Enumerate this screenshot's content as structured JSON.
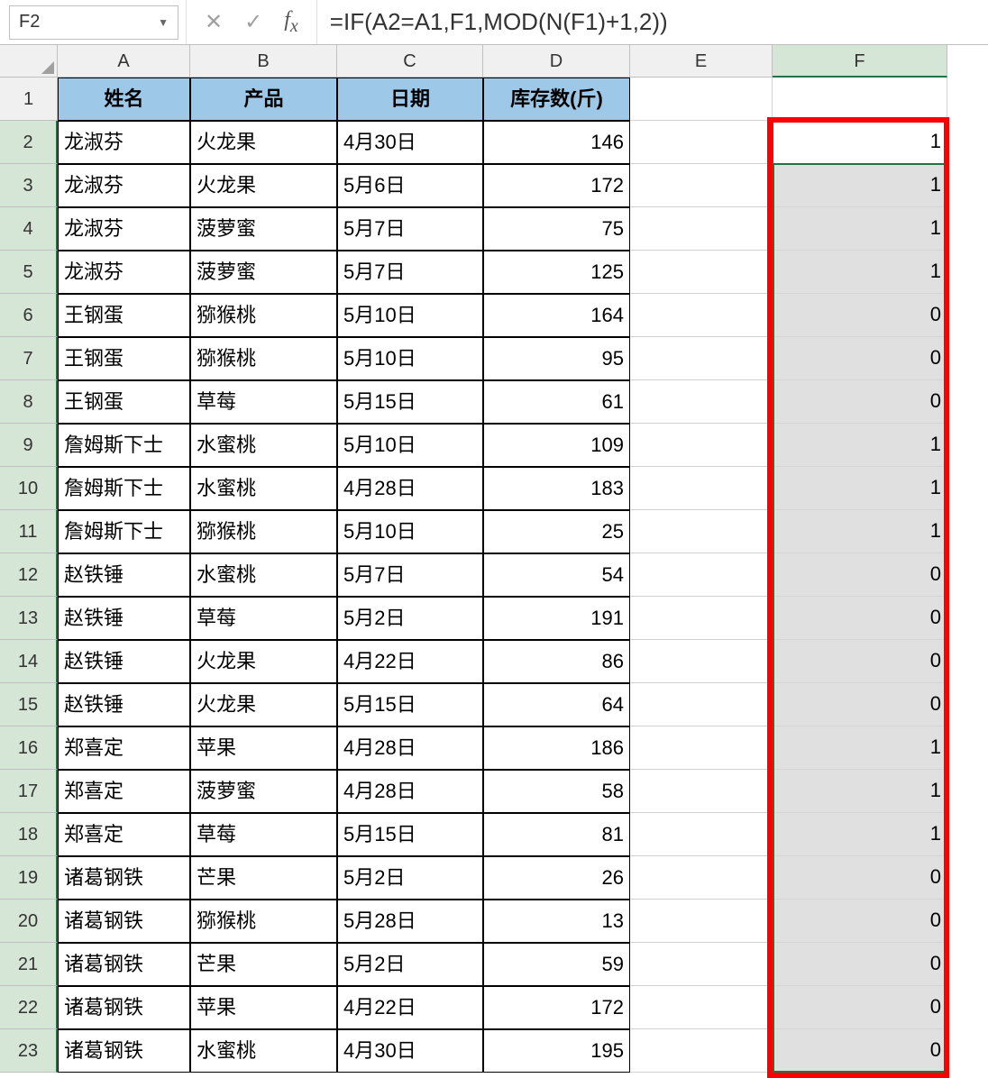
{
  "name_box": "F2",
  "formula": "=IF(A2=A1,F1,MOD(N(F1)+1,2))",
  "columns": [
    "A",
    "B",
    "C",
    "D",
    "E",
    "F"
  ],
  "headers": {
    "A": "姓名",
    "B": "产品",
    "C": "日期",
    "D": "库存数(斤)"
  },
  "rows": [
    {
      "n": 2,
      "A": "龙淑芬",
      "B": "火龙果",
      "C": "4月30日",
      "D": "146",
      "F": "1"
    },
    {
      "n": 3,
      "A": "龙淑芬",
      "B": "火龙果",
      "C": "5月6日",
      "D": "172",
      "F": "1"
    },
    {
      "n": 4,
      "A": "龙淑芬",
      "B": "菠萝蜜",
      "C": "5月7日",
      "D": "75",
      "F": "1"
    },
    {
      "n": 5,
      "A": "龙淑芬",
      "B": "菠萝蜜",
      "C": "5月7日",
      "D": "125",
      "F": "1"
    },
    {
      "n": 6,
      "A": "王钢蛋",
      "B": "猕猴桃",
      "C": "5月10日",
      "D": "164",
      "F": "0"
    },
    {
      "n": 7,
      "A": "王钢蛋",
      "B": "猕猴桃",
      "C": "5月10日",
      "D": "95",
      "F": "0"
    },
    {
      "n": 8,
      "A": "王钢蛋",
      "B": "草莓",
      "C": "5月15日",
      "D": "61",
      "F": "0"
    },
    {
      "n": 9,
      "A": "詹姆斯下士",
      "B": "水蜜桃",
      "C": "5月10日",
      "D": "109",
      "F": "1"
    },
    {
      "n": 10,
      "A": "詹姆斯下士",
      "B": "水蜜桃",
      "C": "4月28日",
      "D": "183",
      "F": "1"
    },
    {
      "n": 11,
      "A": "詹姆斯下士",
      "B": "猕猴桃",
      "C": "5月10日",
      "D": "25",
      "F": "1"
    },
    {
      "n": 12,
      "A": "赵铁锤",
      "B": "水蜜桃",
      "C": "5月7日",
      "D": "54",
      "F": "0"
    },
    {
      "n": 13,
      "A": "赵铁锤",
      "B": "草莓",
      "C": "5月2日",
      "D": "191",
      "F": "0"
    },
    {
      "n": 14,
      "A": "赵铁锤",
      "B": "火龙果",
      "C": "4月22日",
      "D": "86",
      "F": "0"
    },
    {
      "n": 15,
      "A": "赵铁锤",
      "B": "火龙果",
      "C": "5月15日",
      "D": "64",
      "F": "0"
    },
    {
      "n": 16,
      "A": "郑喜定",
      "B": "苹果",
      "C": "4月28日",
      "D": "186",
      "F": "1"
    },
    {
      "n": 17,
      "A": "郑喜定",
      "B": "菠萝蜜",
      "C": "4月28日",
      "D": "58",
      "F": "1"
    },
    {
      "n": 18,
      "A": "郑喜定",
      "B": "草莓",
      "C": "5月15日",
      "D": "81",
      "F": "1"
    },
    {
      "n": 19,
      "A": "诸葛钢铁",
      "B": "芒果",
      "C": "5月2日",
      "D": "26",
      "F": "0"
    },
    {
      "n": 20,
      "A": "诸葛钢铁",
      "B": "猕猴桃",
      "C": "5月28日",
      "D": "13",
      "F": "0"
    },
    {
      "n": 21,
      "A": "诸葛钢铁",
      "B": "芒果",
      "C": "5月2日",
      "D": "59",
      "F": "0"
    },
    {
      "n": 22,
      "A": "诸葛钢铁",
      "B": "苹果",
      "C": "4月22日",
      "D": "172",
      "F": "0"
    },
    {
      "n": 23,
      "A": "诸葛钢铁",
      "B": "水蜜桃",
      "C": "4月30日",
      "D": "195",
      "F": "0"
    }
  ],
  "active_cell": "F2",
  "selected_range_start_row": 3,
  "selected_range_end_row": 23
}
